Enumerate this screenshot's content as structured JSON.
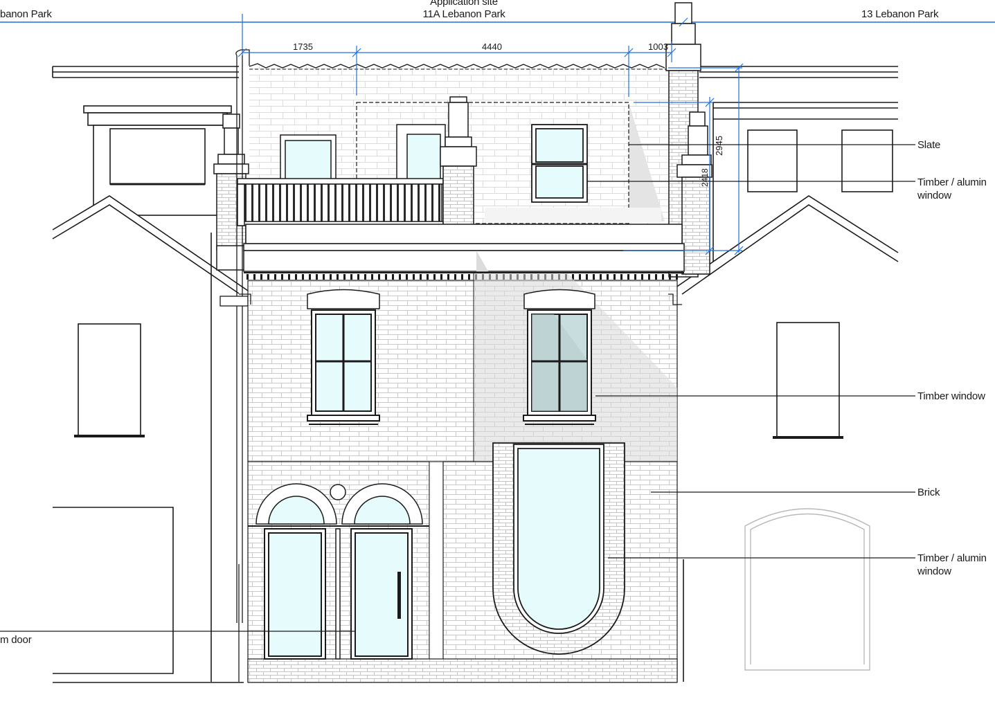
{
  "neighbours": {
    "left": "banon Park",
    "right": "13 Lebanon Park"
  },
  "application_site": {
    "line1": "Application site",
    "line2": "11A Lebanon Park"
  },
  "dimensions": {
    "d1": "1735",
    "d2": "4440",
    "d3": "1003",
    "height_outer": "2945",
    "height_inner": "2418"
  },
  "annotations": {
    "slate": "Slate",
    "roof_window_line1": "Timber / alumin",
    "roof_window_line2": "window",
    "timber_window": "Timber window",
    "brick": "Brick",
    "ground_window_line1": "Timber / alumin",
    "ground_window_line2": "window",
    "door": "m door"
  },
  "colors": {
    "line": "#1a1a1a",
    "dimension": "#1f6fe0",
    "glass": "#e6fbfb",
    "shade": "#e2e2e2",
    "brick_joint": "#c9c9c9"
  }
}
